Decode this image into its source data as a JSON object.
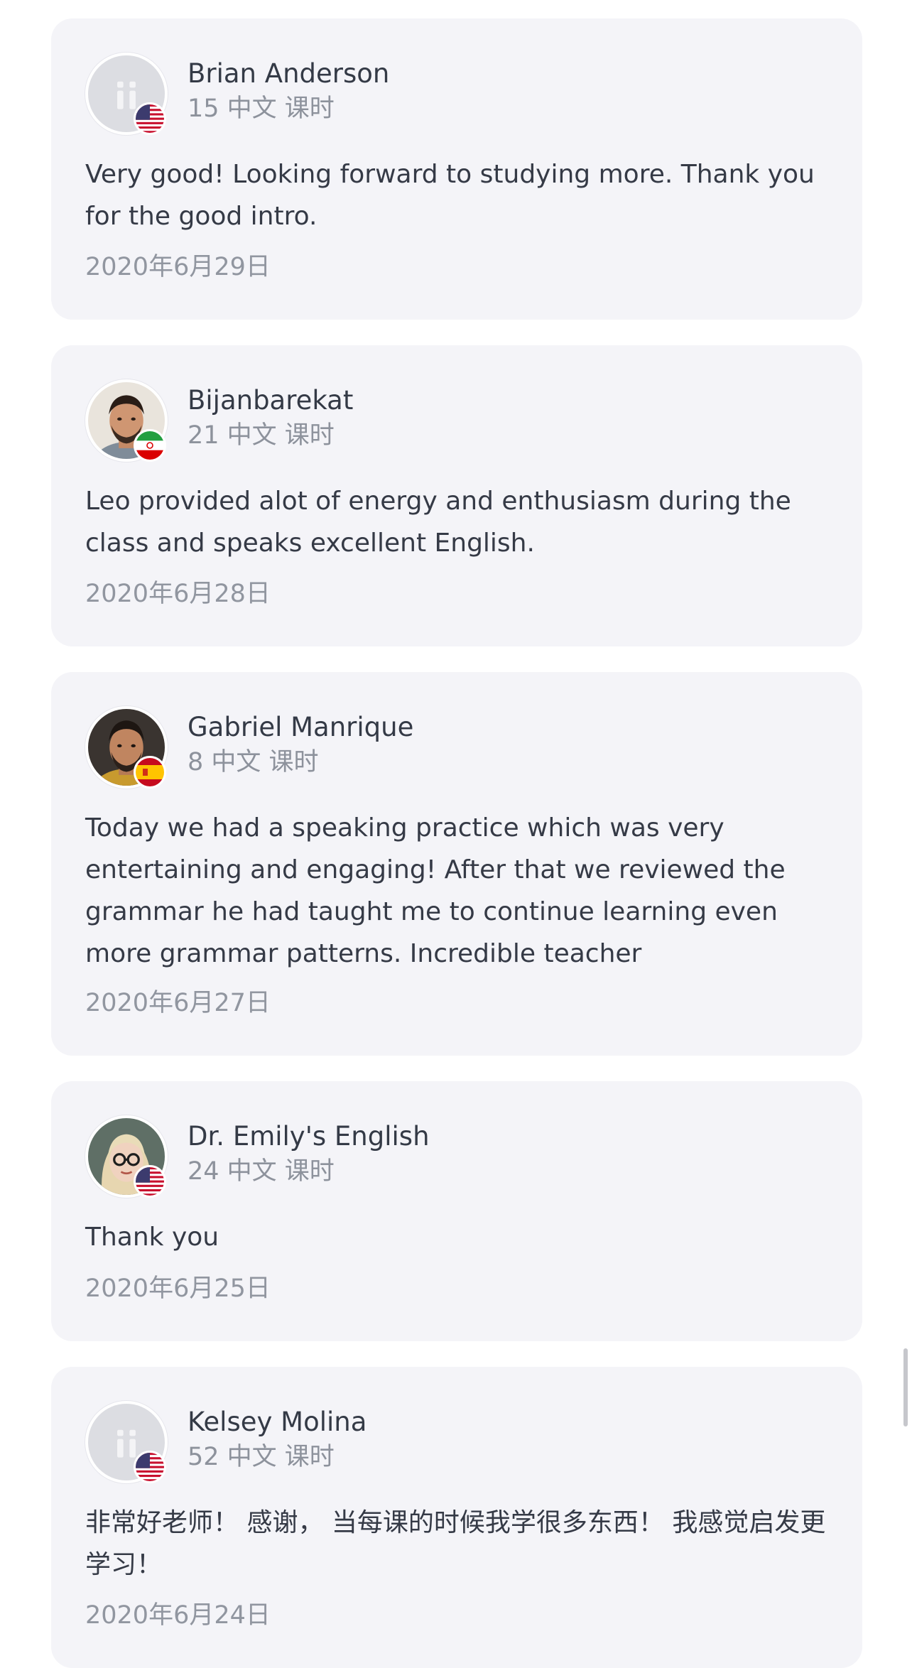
{
  "reviews": [
    {
      "name": "Brian Anderson",
      "lessons": "15 中文 课时",
      "comment": "Very good! Looking forward to studying more. Thank you for the good intro.",
      "date": "2020年6月29日",
      "avatar": "default-avatar-icon",
      "flag": "us-flag-icon"
    },
    {
      "name": "Bijanbarekat",
      "lessons": "21 中文 课时",
      "comment": "Leo provided alot of energy and enthusiasm during the class and speaks excellent English.",
      "date": "2020年6月28日",
      "avatar": "user-photo",
      "flag": "iran-flag-icon"
    },
    {
      "name": "Gabriel Manrique",
      "lessons": "8 中文 课时",
      "comment": "Today we had a speaking practice which was very entertaining and engaging! After that we reviewed the grammar he had taught me to continue learning even more grammar patterns. Incredible teacher",
      "date": "2020年6月27日",
      "avatar": "user-photo",
      "flag": "spain-flag-icon"
    },
    {
      "name": "Dr. Emily's English",
      "lessons": "24 中文 课时",
      "comment": "Thank you",
      "date": "2020年6月25日",
      "avatar": "user-photo",
      "flag": "us-flag-icon"
    },
    {
      "name": "Kelsey Molina",
      "lessons": "52 中文 课时",
      "comment": "非常好老师！ 感谢， 当每课的时候我学很多东西！ 我感觉启发更学习！",
      "date": "2020年6月24日",
      "avatar": "default-avatar-icon",
      "flag": "us-flag-icon"
    }
  ],
  "colors": {
    "card_background": "#f4f4f8",
    "primary_text": "#343a46",
    "secondary_text": "#8d929c"
  }
}
